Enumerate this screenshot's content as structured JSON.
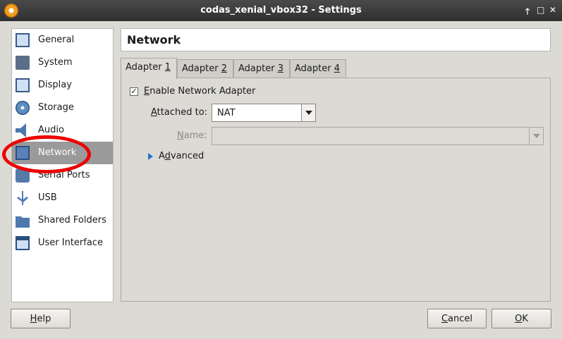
{
  "window": {
    "title": "codas_xenial_vbox32 - Settings",
    "controls": {
      "up": "🡑",
      "minimize": "□",
      "close": "✕"
    }
  },
  "sidebar": {
    "items": [
      {
        "label": "General",
        "icon": "general-icon"
      },
      {
        "label": "System",
        "icon": "system-icon"
      },
      {
        "label": "Display",
        "icon": "display-icon"
      },
      {
        "label": "Storage",
        "icon": "storage-icon"
      },
      {
        "label": "Audio",
        "icon": "audio-icon"
      },
      {
        "label": "Network",
        "icon": "network-icon",
        "selected": true
      },
      {
        "label": "Serial Ports",
        "icon": "serial-ports-icon"
      },
      {
        "label": "USB",
        "icon": "usb-icon"
      },
      {
        "label": "Shared Folders",
        "icon": "shared-folders-icon"
      },
      {
        "label": "User Interface",
        "icon": "user-interface-icon"
      }
    ]
  },
  "section": {
    "title": "Network"
  },
  "tabs": [
    {
      "label_prefix": "Adapter ",
      "mnemonic": "1",
      "active": true
    },
    {
      "label_prefix": "Adapter ",
      "mnemonic": "2"
    },
    {
      "label_prefix": "Adapter ",
      "mnemonic": "3"
    },
    {
      "label_prefix": "Adapter ",
      "mnemonic": "4"
    }
  ],
  "adapter": {
    "enable_label": "Enable Network Adapter",
    "enable_mnemonic": "E",
    "enable_rest": "nable Network Adapter",
    "enabled": true,
    "check_mark": "✓",
    "attached_label": "Attached to:",
    "attached_mnemonic": "A",
    "attached_rest": "ttached to:",
    "attached_value": "NAT",
    "name_label": "Name:",
    "name_mnemonic": "N",
    "name_rest": "ame:",
    "name_value": "",
    "advanced_label": "Advanced",
    "advanced_mnemonic": "d",
    "advanced_before": "A",
    "advanced_after": "vanced"
  },
  "buttons": {
    "help": {
      "mnemonic": "H",
      "rest": "elp"
    },
    "cancel": {
      "mnemonic": "C",
      "rest": "ancel"
    },
    "ok": {
      "mnemonic": "O",
      "rest": "K"
    }
  },
  "colors": {
    "selection": "#9a9a9a",
    "annotation": "#e00000",
    "accent": "#2a6fc9"
  }
}
